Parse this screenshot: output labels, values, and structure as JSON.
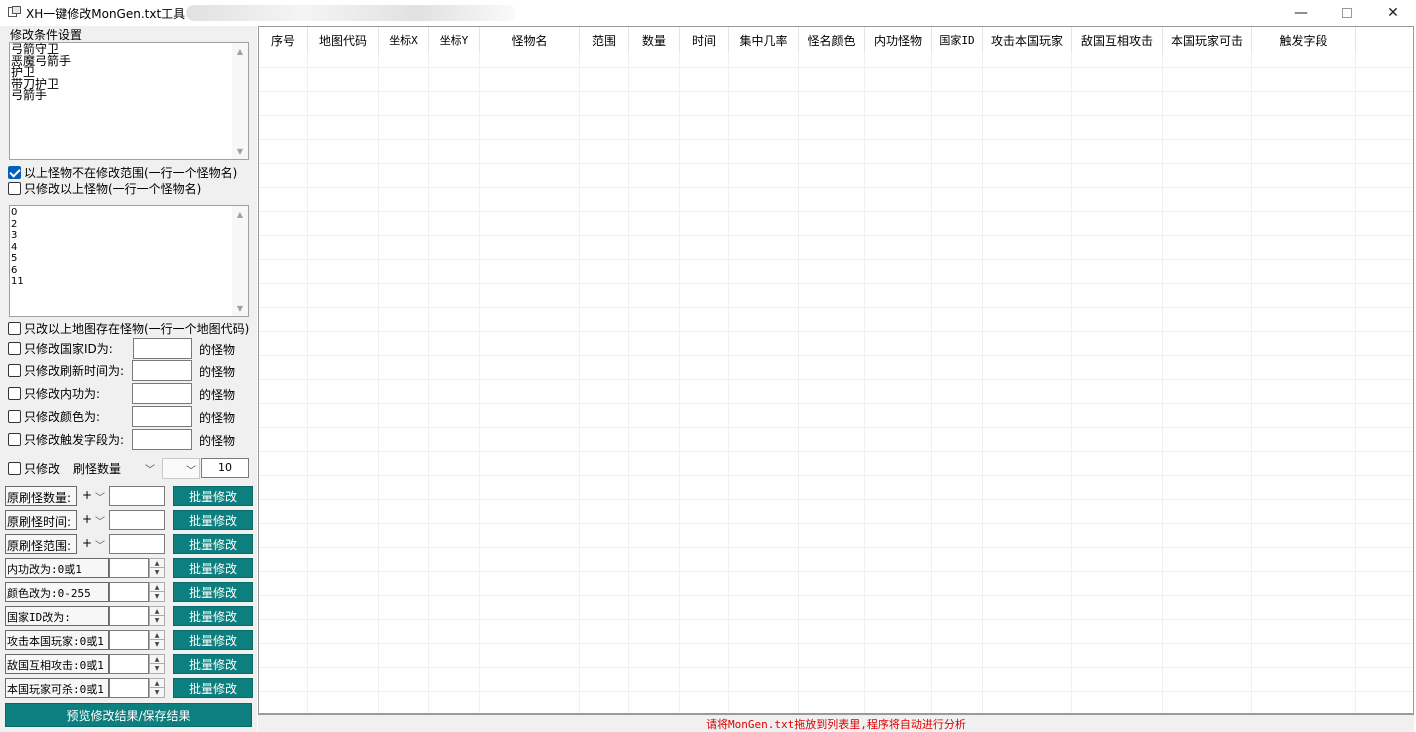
{
  "window": {
    "title": "XH一键修改MonGen.txt工具",
    "minimize": "—",
    "close": "✕"
  },
  "left": {
    "group_label": "修改条件设置",
    "exclude_names": [
      "弓箭守卫",
      "恶魔弓箭手",
      "护卫",
      "带刀护卫",
      "弓箭手"
    ],
    "cb_exclude": {
      "label": "以上怪物不在修改范围(一行一个怪物名)",
      "checked": true
    },
    "cb_only_these": {
      "label": "只修改以上怪物(一行一个怪物名)",
      "checked": false
    },
    "map_codes": [
      "0",
      "2",
      "3",
      "4",
      "5",
      "6",
      "11"
    ],
    "cb_only_maps": {
      "label": "只改以上地图存在怪物(一行一个地图代码)",
      "checked": false
    },
    "filters": [
      {
        "label": "只修改国家ID为:",
        "suffix": "的怪物",
        "value": ""
      },
      {
        "label": "只修改刷新时间为:",
        "suffix": "的怪物",
        "value": ""
      },
      {
        "label": "只修改内功为:",
        "suffix": "的怪物",
        "value": ""
      },
      {
        "label": "只修改颜色为:",
        "suffix": "的怪物",
        "value": ""
      },
      {
        "label": "只修改触发字段为:",
        "suffix": "的怪物",
        "value": ""
      }
    ],
    "only_modify": {
      "label": "只修改",
      "field": "刷怪数量",
      "operator": "",
      "value": "10"
    },
    "batch_rows": [
      {
        "label": "原刷怪数量:",
        "operator": "+",
        "kind": "op",
        "button": "批量修改"
      },
      {
        "label": "原刷怪时间:",
        "operator": "+",
        "kind": "op",
        "button": "批量修改"
      },
      {
        "label": "原刷怪范围:",
        "operator": "+",
        "kind": "op",
        "button": "批量修改"
      },
      {
        "label": "内功改为:0或1",
        "kind": "spin",
        "button": "批量修改"
      },
      {
        "label": "颜色改为:0-255",
        "kind": "spin",
        "button": "批量修改"
      },
      {
        "label": "国家ID改为:",
        "kind": "spin",
        "button": "批量修改"
      },
      {
        "label": "攻击本国玩家:0或1",
        "kind": "spin",
        "button": "批量修改"
      },
      {
        "label": "敌国互相攻击:0或1",
        "kind": "spin",
        "button": "批量修改"
      },
      {
        "label": "本国玩家可杀:0或1",
        "kind": "spin",
        "button": "批量修改"
      }
    ],
    "preview_button": "预览修改结果/保存结果"
  },
  "grid": {
    "columns": [
      "序号",
      "地图代码",
      "坐标X",
      "坐标Y",
      "怪物名",
      "范围",
      "数量",
      "时间",
      "集中几率",
      "怪名颜色",
      "内功怪物",
      "国家ID",
      "攻击本国玩家",
      "敌国互相攻击",
      "本国玩家可击",
      "触发字段"
    ]
  },
  "status": {
    "message": "请将MonGen.txt拖放到列表里,程序将自动进行分析",
    "color": "#e00000"
  }
}
